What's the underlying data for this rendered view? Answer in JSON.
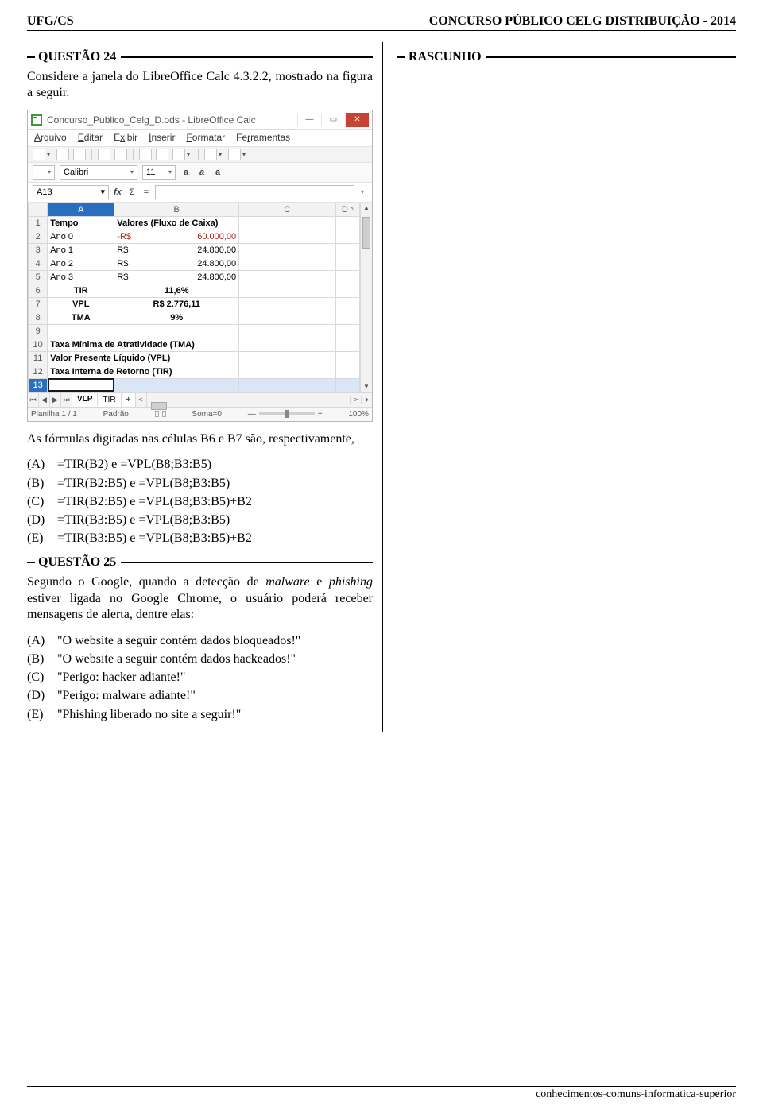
{
  "header": {
    "left": "UFG/CS",
    "right": "CONCURSO PÚBLICO CELG DISTRIBUIÇÃO - 2014"
  },
  "rascunho": {
    "title": "RASCUNHO"
  },
  "q24": {
    "title": "QUESTÃO 24",
    "intro": "Considere a janela do LibreOffice Calc 4.3.2.2, mostrado na figura a seguir.",
    "after": "As fórmulas digitadas nas células B6 e B7 são, respectivamente,",
    "options": [
      {
        "label": "(A)",
        "text": "=TIR(B2) e =VPL(B8;B3:B5)"
      },
      {
        "label": "(B)",
        "text": "=TIR(B2:B5) e =VPL(B8;B3:B5)"
      },
      {
        "label": "(C)",
        "text": "=TIR(B2:B5) e =VPL(B8;B3:B5)+B2"
      },
      {
        "label": "(D)",
        "text": "=TIR(B3:B5) e =VPL(B8;B3:B5)"
      },
      {
        "label": "(E)",
        "text": "=TIR(B3:B5) e =VPL(B8;B3:B5)+B2"
      }
    ]
  },
  "q25": {
    "title": "QUESTÃO 25",
    "intro": "Segundo o Google, quando a detecção de malware e phishing estiver ligada no Google Chrome, o usuário poderá receber mensagens de alerta, dentre elas:",
    "options": [
      {
        "label": "(A)",
        "text": "\"O website a seguir contém dados bloqueados!\""
      },
      {
        "label": "(B)",
        "text": "\"O website a seguir contém dados hackeados!\""
      },
      {
        "label": "(C)",
        "text": "\"Perigo: hacker adiante!\""
      },
      {
        "label": "(D)",
        "text": "\"Perigo: malware adiante!\""
      },
      {
        "label": "(E)",
        "text": "\"Phishing liberado no site a seguir!\""
      }
    ]
  },
  "app": {
    "title": "Concurso_Publico_Celg_D.ods - LibreOffice Calc",
    "win": {
      "min": "—",
      "max": "▭",
      "close": "✕"
    },
    "menus": [
      "Arquivo",
      "Editar",
      "Exibir",
      "Inserir",
      "Formatar",
      "Ferramentas"
    ],
    "font": {
      "name": "Calibri",
      "size": "11"
    },
    "cellref": "A13",
    "fx": "fx",
    "sigma": "Σ",
    "eq": "=",
    "cols": [
      "",
      "A",
      "B",
      "C",
      "D"
    ],
    "rows": [
      {
        "n": "1",
        "a": "Tempo",
        "b": "Valores (Fluxo de Caixa)",
        "c": "",
        "bold": true
      },
      {
        "n": "2",
        "a": "Ano 0",
        "b_pre": "-R$",
        "b_val": "60.000,00",
        "c": "",
        "neg": true
      },
      {
        "n": "3",
        "a": "Ano 1",
        "b_pre": "R$",
        "b_val": "24.800,00",
        "c": ""
      },
      {
        "n": "4",
        "a": "Ano 2",
        "b_pre": "R$",
        "b_val": "24.800,00",
        "c": ""
      },
      {
        "n": "5",
        "a": "Ano 3",
        "b_pre": "R$",
        "b_val": "24.800,00",
        "c": ""
      },
      {
        "n": "6",
        "a": "TIR",
        "b_center": "11,6%",
        "c": "",
        "bold": true
      },
      {
        "n": "7",
        "a": "VPL",
        "b_center": "R$ 2.776,11",
        "c": "",
        "bold": true
      },
      {
        "n": "8",
        "a": "TMA",
        "b_center": "9%",
        "c": "",
        "bold": true
      },
      {
        "n": "9",
        "a": "",
        "b": "",
        "c": ""
      },
      {
        "n": "10",
        "wide": "Taxa Mínima de Atratividade (TMA)",
        "bold": true
      },
      {
        "n": "11",
        "wide": "Valor Presente Líquido (VPL)",
        "bold": true
      },
      {
        "n": "12",
        "wide": "Taxa Interna de Retorno (TIR)",
        "bold": true
      },
      {
        "n": "13",
        "sel": true
      }
    ],
    "sheet_tabs": {
      "active": "VLP",
      "other": "TIR",
      "add": "+"
    },
    "nav": {
      "first": "⏮",
      "prev": "◀",
      "next": "▶",
      "last": "⏭",
      "scroll_left": "<",
      "scroll_right": ">",
      "vscroll_up": "▲",
      "vscroll_down": "▼"
    },
    "status": {
      "sheet": "Planilha 1 / 1",
      "style": "Padrão",
      "sum": "Soma=0",
      "zoom_minus": "—",
      "zoom_plus": "+",
      "zoom": "100%"
    }
  },
  "footer": "conhecimentos-comuns-informatica-superior"
}
